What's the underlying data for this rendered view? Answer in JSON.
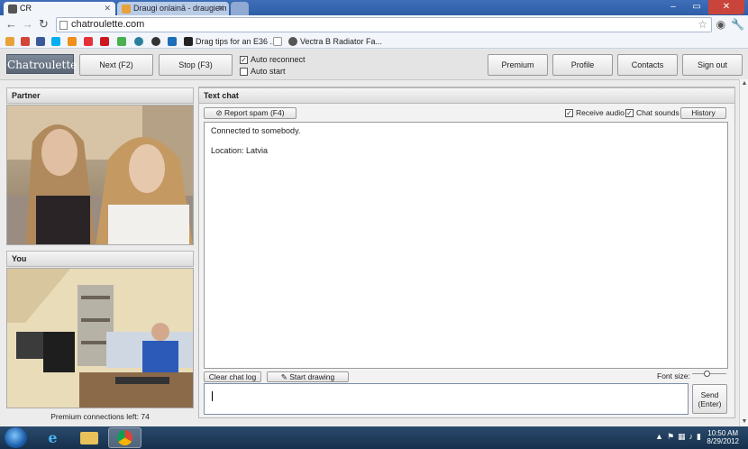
{
  "browser": {
    "tabs": [
      {
        "title": "CR",
        "active": true
      },
      {
        "title": "Draugi onlainā - draugiem",
        "active": false
      }
    ],
    "url": "chatroulette.com",
    "bookmarks": [
      {
        "label": "Drag tips for an E36 ..."
      },
      {
        "label": "Vectra B Radiator Fa..."
      }
    ]
  },
  "app": {
    "logo": "Chatroulette",
    "next_label": "Next (F2)",
    "stop_label": "Stop (F3)",
    "auto_reconnect": {
      "label": "Auto reconnect",
      "checked": true
    },
    "auto_start": {
      "label": "Auto start",
      "checked": false
    },
    "premium_label": "Premium",
    "profile_label": "Profile",
    "contacts_label": "Contacts",
    "signout_label": "Sign out"
  },
  "partner": {
    "title": "Partner"
  },
  "you": {
    "title": "You",
    "premium_connections": "Premium connections left: 74"
  },
  "chat": {
    "title": "Text chat",
    "report_label": "Report spam (F4)",
    "receive_audio": {
      "label": "Receive audio",
      "checked": true
    },
    "chat_sounds": {
      "label": "Chat sounds",
      "checked": true
    },
    "history_label": "History",
    "messages": [
      "Connected to somebody.",
      "Location: Latvia"
    ],
    "clear_label": "Clear chat log",
    "draw_label": "Start drawing",
    "font_size_label": "Font size:",
    "send_label_1": "Send",
    "send_label_2": "(Enter)"
  },
  "taskbar": {
    "time": "10:50 AM",
    "date": "8/29/2012"
  },
  "colors": {
    "accent": "#2e5ea7",
    "logo": "#6a7585",
    "taskbar": "#1f3b5c"
  }
}
